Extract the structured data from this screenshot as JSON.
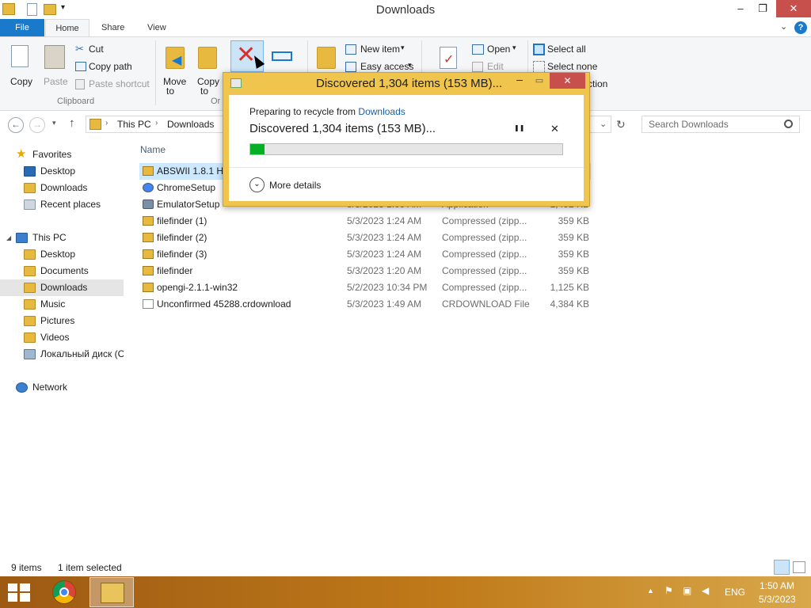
{
  "window": {
    "title": "Downloads",
    "minimize": "–",
    "maximize": "❐",
    "close": "✕",
    "help": "?"
  },
  "tabs": [
    {
      "label": "File"
    },
    {
      "label": "Home"
    },
    {
      "label": "Share"
    },
    {
      "label": "View"
    }
  ],
  "ribbon": {
    "copy": "Copy",
    "paste": "Paste",
    "cut": "Cut",
    "copy_path": "Copy path",
    "paste_shortcut": "Paste shortcut",
    "clipboard_group": "Clipboard",
    "move_to_1": "Move",
    "move_to_2": "to",
    "copy_to_1": "Copy",
    "copy_to_2": "to",
    "organize_group": "Or",
    "new_item": "New item",
    "easy_access": "Easy access",
    "open": "Open",
    "edit": "Edit",
    "select_all": "Select all",
    "select_none": "Select none",
    "invert_selection": "ction"
  },
  "address": {
    "segments": [
      "This PC",
      "Downloads"
    ],
    "search_placeholder": "Search Downloads"
  },
  "sidebar": {
    "favorites": "Favorites",
    "fav_items": [
      "Desktop",
      "Downloads",
      "Recent places"
    ],
    "this_pc": "This PC",
    "pc_items": [
      "Desktop",
      "Documents",
      "Downloads",
      "Music",
      "Pictures",
      "Videos",
      "Локальный диск (C"
    ],
    "network": "Network"
  },
  "file_list": {
    "name_header": "Name",
    "rows": [
      {
        "name": "ABSWII 1.8.1 Ha",
        "date": "",
        "type": "",
        "size": "",
        "icon": "folder-icon"
      },
      {
        "name": "ChromeSetup",
        "date": "",
        "type": "",
        "size": "",
        "icon": "chrome-icon"
      },
      {
        "name": "EmulatorSetup",
        "date": "5/3/2023 1:09 AM",
        "type": "Application",
        "size": "1,452 KB",
        "icon": "app-icon"
      },
      {
        "name": "filefinder (1)",
        "date": "5/3/2023 1:24 AM",
        "type": "Compressed (zipp...",
        "size": "359 KB",
        "icon": "zip-folder-icon"
      },
      {
        "name": "filefinder (2)",
        "date": "5/3/2023 1:24 AM",
        "type": "Compressed (zipp...",
        "size": "359 KB",
        "icon": "zip-folder-icon"
      },
      {
        "name": "filefinder (3)",
        "date": "5/3/2023 1:24 AM",
        "type": "Compressed (zipp...",
        "size": "359 KB",
        "icon": "zip-folder-icon"
      },
      {
        "name": "filefinder",
        "date": "5/3/2023 1:20 AM",
        "type": "Compressed (zipp...",
        "size": "359 KB",
        "icon": "zip-folder-icon"
      },
      {
        "name": "opengi-2.1.1-win32",
        "date": "5/2/2023 10:34 PM",
        "type": "Compressed (zipp...",
        "size": "1,125 KB",
        "icon": "zip-folder-icon"
      },
      {
        "name": "Unconfirmed 45288.crdownload",
        "date": "5/3/2023 1:49 AM",
        "type": "CRDOWNLOAD File",
        "size": "4,384 KB",
        "icon": "file-icon"
      }
    ]
  },
  "status": {
    "item_count": "9 items",
    "selected": "1 item selected"
  },
  "dialog": {
    "title": "Discovered 1,304 items (153 MB)...",
    "preparing": "Preparing to recycle from",
    "source": "Downloads",
    "heading": "Discovered 1,304 items (153 MB)...",
    "progress": 0.045,
    "more_details": "More details",
    "pause": "❚❚",
    "cancel": "✕"
  },
  "taskbar": {
    "language": "ENG",
    "time": "1:50 AM",
    "date": "5/3/2023"
  }
}
